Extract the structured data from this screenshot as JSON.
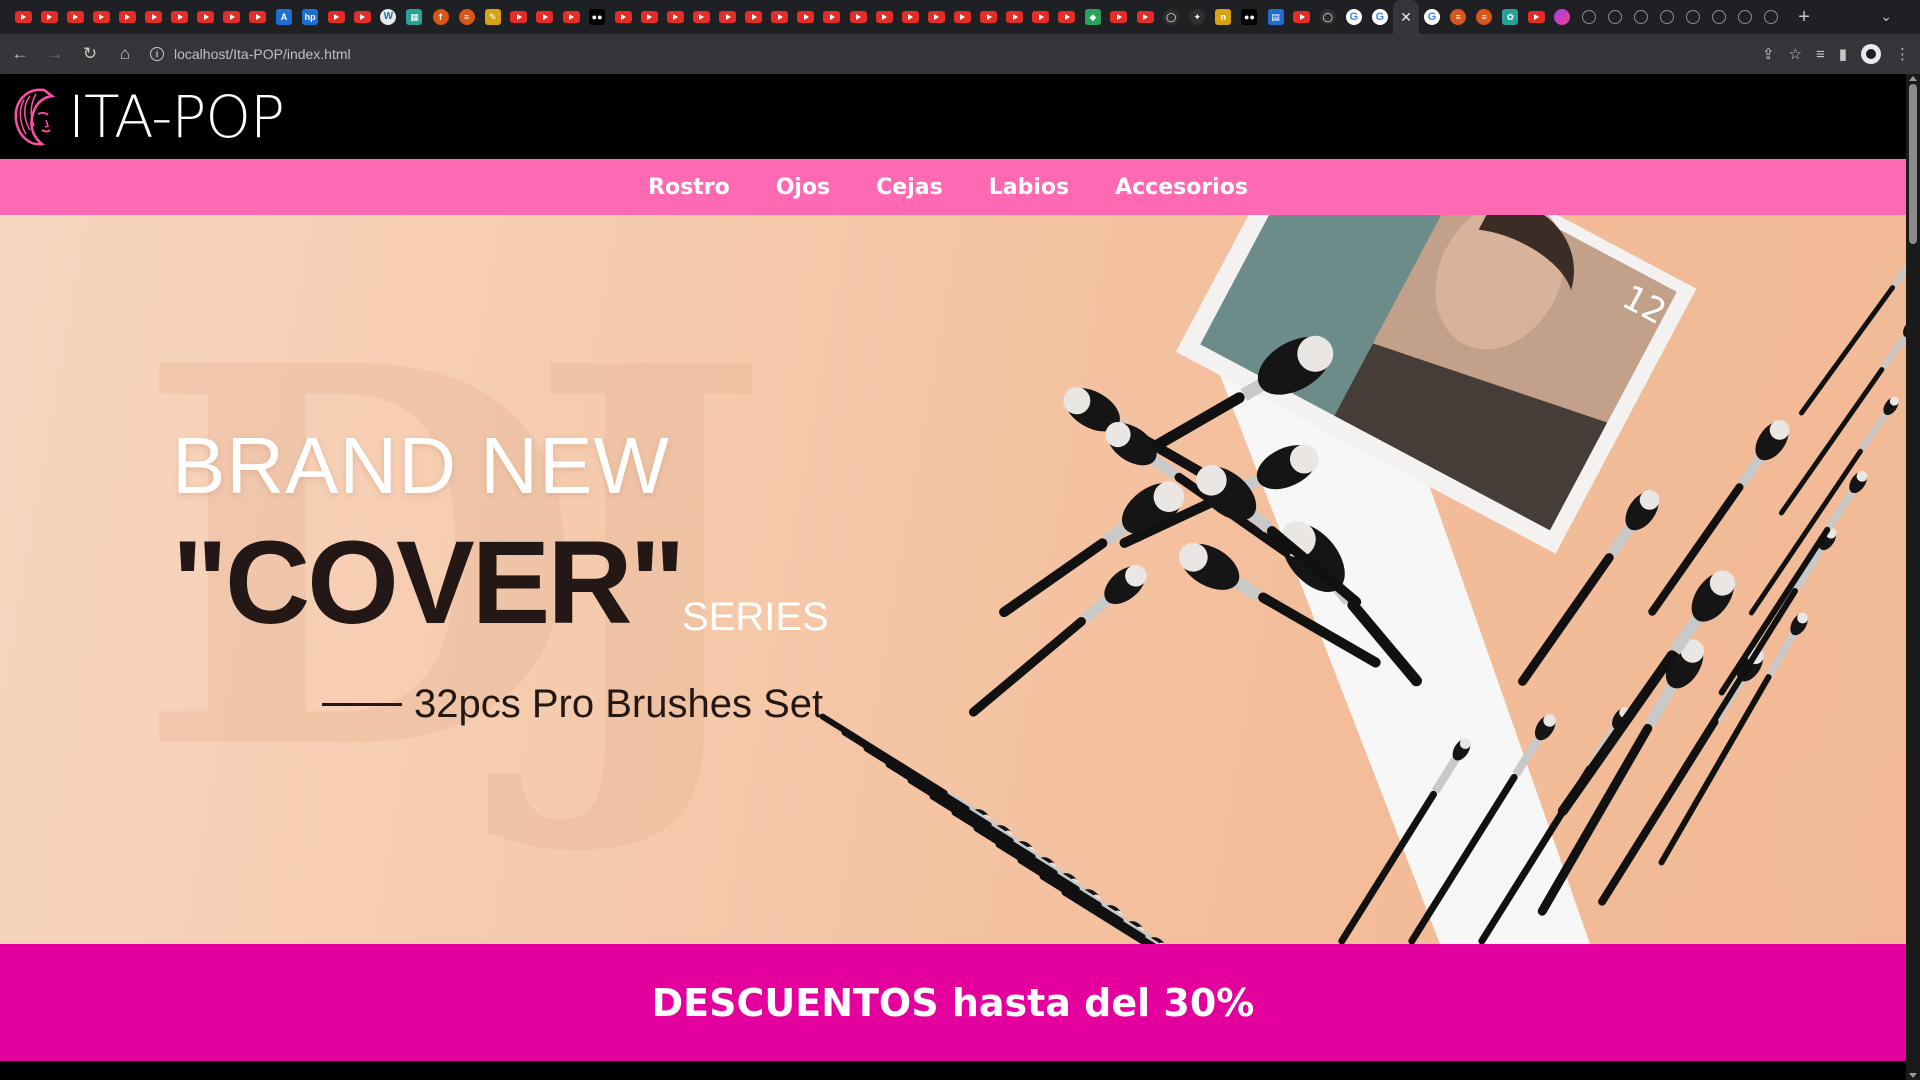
{
  "browser": {
    "tabs": [
      "youtube",
      "youtube",
      "youtube",
      "youtube",
      "youtube",
      "youtube",
      "youtube",
      "youtube",
      "youtube",
      "youtube",
      "arch",
      "hp",
      "youtube",
      "youtube",
      "wordpress",
      "photo",
      "firefox",
      "stack",
      "pen",
      "youtube",
      "youtube",
      "youtube",
      "medium",
      "youtube",
      "youtube",
      "youtube",
      "youtube",
      "youtube",
      "youtube",
      "youtube",
      "youtube",
      "youtube",
      "youtube",
      "youtube",
      "youtube",
      "youtube",
      "youtube",
      "youtube",
      "youtube",
      "youtube",
      "youtube",
      "green",
      "youtube",
      "youtube",
      "github",
      "star",
      "notion",
      "medium",
      "doc",
      "youtube",
      "github",
      "google",
      "google",
      "active",
      "google",
      "stack",
      "stack",
      "teal",
      "youtube",
      "purple",
      "globe",
      "globe",
      "globe",
      "globe",
      "globe",
      "globe",
      "globe",
      "globe"
    ],
    "active_tab_close": "✕",
    "new_tab": "+",
    "url": "localhost/Ita-POP/index.html"
  },
  "site": {
    "logo_text": "ITA-POP",
    "nav": [
      "Rostro",
      "Ojos",
      "Cejas",
      "Labios",
      "Accesorios"
    ],
    "banner": {
      "watermark": "DJ",
      "line1": "BRAND NEW",
      "line2": "\"COVER\"",
      "series": "SERIES",
      "line3": "32pcs Pro Brushes Set"
    },
    "promo": "DESCUENTOS hasta del 30%"
  },
  "colors": {
    "nav_bg": "#ff69b4",
    "promo_bg": "#e3009c",
    "header_bg": "#000000"
  }
}
